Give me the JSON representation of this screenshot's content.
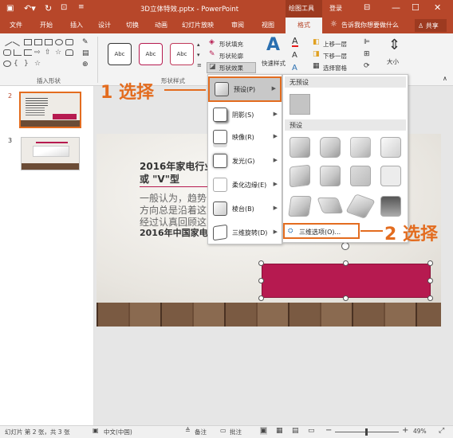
{
  "titlebar": {
    "doc_title": "3D立体特效.pptx - PowerPoint",
    "drawing_tools": "绘图工具",
    "login": "登录"
  },
  "tabs": [
    "文件",
    "开始",
    "插入",
    "设计",
    "切换",
    "动画",
    "幻灯片放映",
    "审阅",
    "视图",
    "格式"
  ],
  "tell_me": "告诉我你想要做什么",
  "share": "共享",
  "ribbon": {
    "style_samples": [
      "Abc",
      "Abc",
      "Abc"
    ],
    "shape_fill": "形状填充",
    "shape_outline": "形状轮廓",
    "shape_effects": "形状效果",
    "quick_styles": "快速样式",
    "bring_forward": "上移一层",
    "send_backward": "下移一层",
    "selection_pane": "选择窗格",
    "size": "大小",
    "group_insert_shapes": "插入形状",
    "group_shape_styles": "形状样式"
  },
  "thumbnails": [
    {
      "num": "2"
    },
    {
      "num": "3"
    }
  ],
  "slide": {
    "title_line1": "2016年家电行业",
    "title_line2": "或 \"V\"型",
    "body_line1": "一般认为，趋势",
    "body_line2": "方向总是沿着这",
    "body_line3": "经过认真回顾这",
    "body_line4": "2016年中国家电"
  },
  "effects_menu": {
    "items": [
      {
        "label": "预设(P)"
      },
      {
        "label": "阴影(S)"
      },
      {
        "label": "映像(R)"
      },
      {
        "label": "发光(G)"
      },
      {
        "label": "柔化边缘(E)"
      },
      {
        "label": "棱台(B)"
      },
      {
        "label": "三维旋转(D)"
      }
    ]
  },
  "preset_submenu": {
    "no_preset_header": "无预设",
    "preset_header": "预设",
    "three_d_options": "三维选项(O)..."
  },
  "annotations": {
    "step1": "1 选择",
    "step2": "2 选择"
  },
  "statusbar": {
    "slide_info": "幻灯片 第 2 张，共 3 张",
    "language": "中文(中国)",
    "notes": "备注",
    "comments": "批注",
    "zoom": "49%"
  },
  "colors": {
    "accent": "#b7472a",
    "highlight": "#e36c1f",
    "shape_fill": "#b61a50"
  }
}
